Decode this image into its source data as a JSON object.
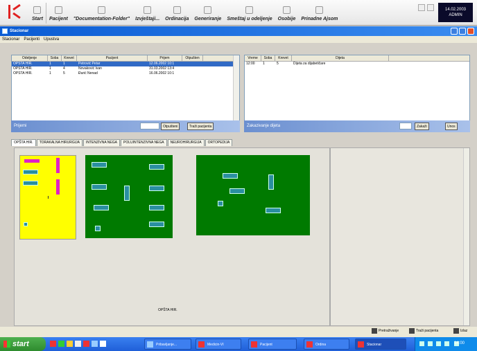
{
  "toolbar": {
    "items": [
      "Start",
      "Pacijent",
      "\"Documentation-Folder\"",
      "Izvještaji...",
      "Ordinacija",
      "Generiranje",
      "Smeštaj u odeljenje",
      "Osobije",
      "Prinadne Ajsom"
    ],
    "clock_time": "14.02.2003",
    "clock_user": "ADMIN"
  },
  "window": {
    "title": "Stacionar",
    "menu": [
      "Stacionar",
      "Pacijenti",
      "Upustva"
    ]
  },
  "left_grid": {
    "columns": [
      "Odeljenje",
      "Soba",
      "Krevet",
      "Pacijent",
      "Prijem",
      "Otpušten"
    ],
    "rows": [
      {
        "cells": [
          "OPŠTA HIR.",
          "1",
          "1",
          "Petrović Petar",
          "12.06.2002 10:1",
          ""
        ],
        "selected": true
      },
      {
        "cells": [
          "OPŠTA HIR.",
          "1",
          "4",
          "Novaković Ivan",
          "31.03.2002 13:4",
          ""
        ],
        "selected": false
      },
      {
        "cells": [
          "OPŠTA HIR.",
          "1",
          "5",
          "Đurić Nenad",
          "16.06.2002 10:1",
          ""
        ],
        "selected": false
      }
    ]
  },
  "right_grid": {
    "columns": [
      "Vreme",
      "Soba",
      "Krevet",
      "Dijeta"
    ],
    "rows": [
      {
        "cells": [
          "12:00",
          "1",
          "5",
          "Dijeta za dijabetičare"
        ]
      }
    ]
  },
  "left_status": {
    "label": "Prijemi",
    "btn_otpusteni": "Otpušteni",
    "btn_trazi": "Traži pacijenta"
  },
  "right_status": {
    "label": "Zakazivanje dijeta",
    "btn_zakazi": "Zakaži",
    "btn_unos": "Unos"
  },
  "tabs": [
    "OPŠTA HIR.",
    "TORAKALNA HIRURGIJA",
    "INTENZIVNA NEGA",
    "POLUINTENZIVNA NEGA",
    "NEUROHIRURGIJA",
    "ORTOPEDIJA"
  ],
  "ward_label": "OPŠTA HIR.",
  "bottom_bar": {
    "btn_pretrazivanje": "Pretraživanje",
    "btn_trazi": "Traži pacijenta",
    "btn_izlaz": "Izlaz"
  },
  "taskbar": {
    "start": "start",
    "tasks": [
      "Pribavljanje...",
      "Medicin-VI",
      "Pacijent",
      "Ordina",
      "Stacionar"
    ],
    "tray_time": "14:00"
  },
  "colors": {
    "yellow_room": "#ffff00",
    "green_room": "#007a00",
    "bed_occupied": "#e020c8",
    "bed_free": "#2a8fa0",
    "selection": "#316ac5"
  }
}
